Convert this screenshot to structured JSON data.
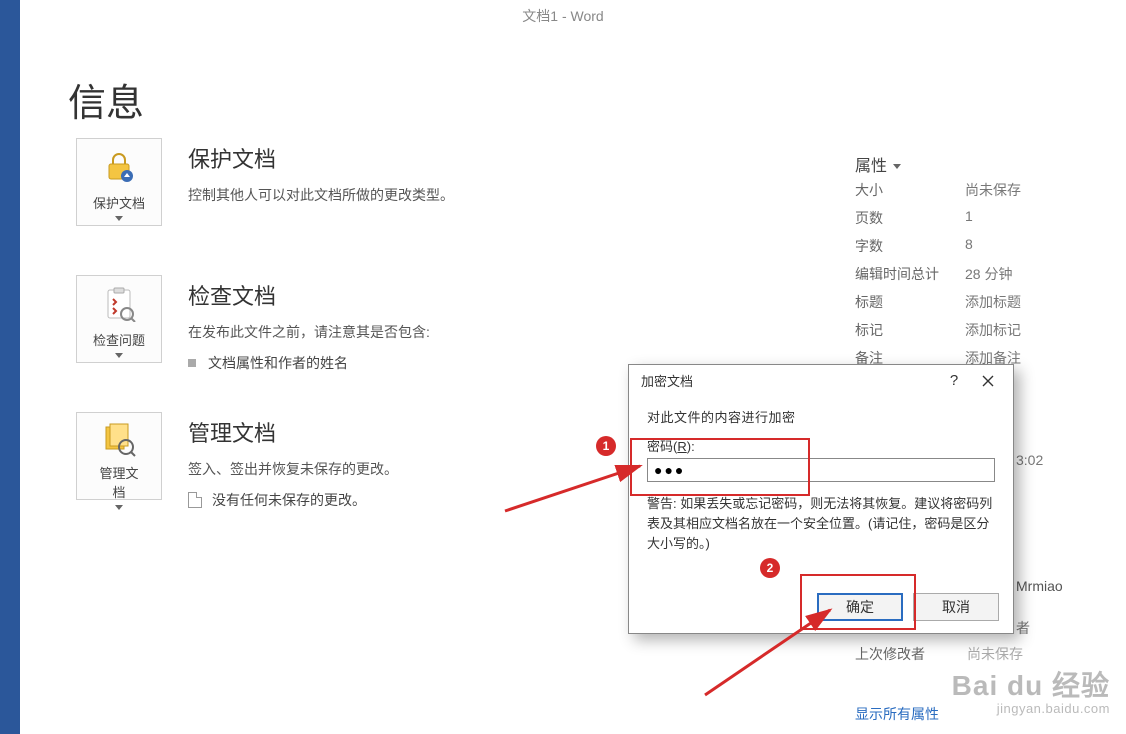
{
  "window_title": "文档1 - Word",
  "page_heading": "信息",
  "sections": {
    "protect": {
      "card_label": "保护文档",
      "title": "保护文档",
      "desc": "控制其他人可以对此文档所做的更改类型。"
    },
    "inspect": {
      "card_label": "检查问题",
      "title": "检查文档",
      "desc": "在发布此文件之前，请注意其是否包含:",
      "bullet1": "文档属性和作者的姓名"
    },
    "manage": {
      "card_label": "管理文\n档",
      "title": "管理文档",
      "desc": "签入、签出并恢复未保存的更改。",
      "empty": "没有任何未保存的更改。"
    }
  },
  "props": {
    "heading": "属性",
    "rows": [
      {
        "k": "大小",
        "v": "尚未保存"
      },
      {
        "k": "页数",
        "v": "1"
      },
      {
        "k": "字数",
        "v": "8"
      },
      {
        "k": "编辑时间总计",
        "v": "28 分钟"
      },
      {
        "k": "标题",
        "v": "添加标题"
      },
      {
        "k": "标记",
        "v": "添加标记"
      },
      {
        "k": "备注",
        "v": "添加备注"
      }
    ],
    "extra_time": "3:02",
    "author": "Mrmiao",
    "last_mod_label": "上次修改者",
    "last_mod_value": "尚未保存",
    "author_label_hidden": "者",
    "show_all": "显示所有属性"
  },
  "dialog": {
    "title": "加密文档",
    "instruction": "对此文件的内容进行加密",
    "password_label_pre": "密码(",
    "password_label_key": "R",
    "password_label_post": "):",
    "password_value": "●●●",
    "warning": "警告: 如果丢失或忘记密码，则无法将其恢复。建议将密码列表及其相应文档名放在一个安全位置。(请记住，密码是区分大小写的。)",
    "ok": "确定",
    "cancel": "取消"
  },
  "annotations": {
    "badge1": "1",
    "badge2": "2"
  },
  "watermark": {
    "line1": "Bai du 经验",
    "line2": "jingyan.baidu.com"
  }
}
